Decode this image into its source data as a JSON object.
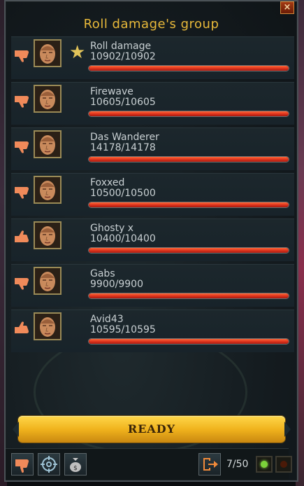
{
  "window": {
    "title": "Roll damage's group",
    "close_label": "×"
  },
  "members": [
    {
      "name": "Roll damage",
      "hp": "10902/10902",
      "vote": "down",
      "leader": true,
      "hp_fraction": 1.0
    },
    {
      "name": "Firewave",
      "hp": "10605/10605",
      "vote": "down",
      "leader": false,
      "hp_fraction": 1.0
    },
    {
      "name": "Das Wanderer",
      "hp": "14178/14178",
      "vote": "down",
      "leader": false,
      "hp_fraction": 1.0
    },
    {
      "name": "Foxxed",
      "hp": "10500/10500",
      "vote": "down",
      "leader": false,
      "hp_fraction": 1.0
    },
    {
      "name": "Ghosty x",
      "hp": "10400/10400",
      "vote": "up",
      "leader": false,
      "hp_fraction": 1.0
    },
    {
      "name": "Gabs",
      "hp": "9900/9900",
      "vote": "down",
      "leader": false,
      "hp_fraction": 1.0
    },
    {
      "name": "Avid43",
      "hp": "10595/10595",
      "vote": "up",
      "leader": false,
      "hp_fraction": 1.0
    }
  ],
  "ready_button": {
    "label": "READY"
  },
  "toolbar": {
    "count": "7/50",
    "icons": [
      "thumbs-down-icon",
      "crosshair-icon",
      "money-bag-icon",
      "exit-icon"
    ],
    "toggles": [
      {
        "name": "green-light",
        "color": "#7bd23a"
      },
      {
        "name": "red-light",
        "color": "#4a1a08"
      }
    ]
  },
  "colors": {
    "title": "#e8b93a",
    "hp_bar": "#e0351d",
    "ready": "#f0b31d",
    "thumb": "#f08a5a"
  }
}
